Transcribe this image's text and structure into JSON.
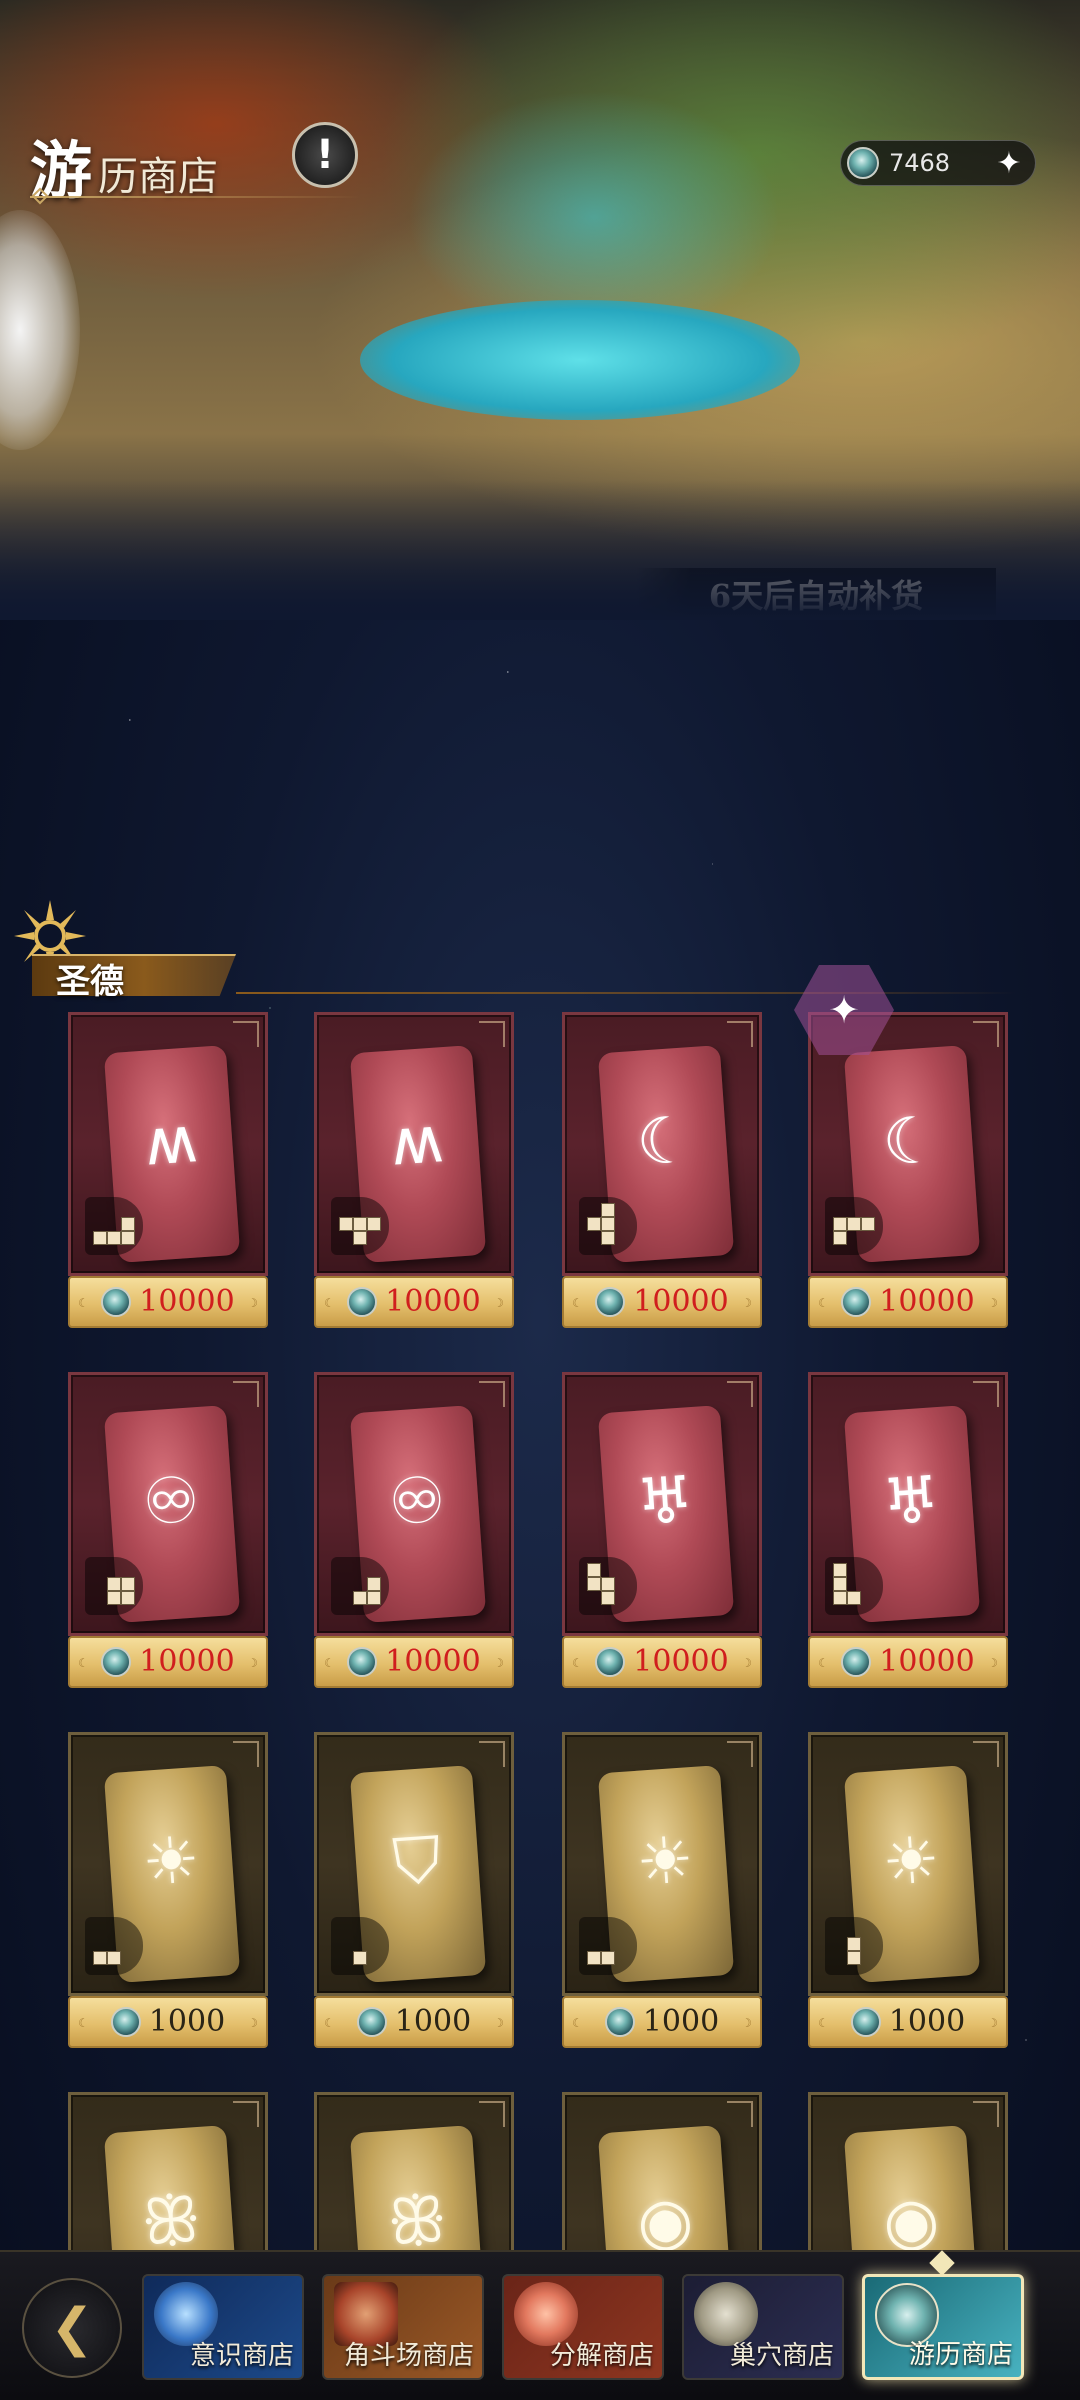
{
  "header": {
    "title_big": "游",
    "title_rest": "历商店",
    "info_icon": "exclamation-icon",
    "currency": {
      "icon": "coin-icon",
      "value": "7468",
      "add_icon": "sparkle-plus-icon"
    },
    "restock_text": "6天后自动补货"
  },
  "section": {
    "title": "圣德",
    "icon": "sun-emblem-icon"
  },
  "items": [
    {
      "glyph": "claw-icon",
      "symbol": "ʍ",
      "tier": "red",
      "price": "10000",
      "shape": "L-4"
    },
    {
      "glyph": "claw-icon",
      "symbol": "ʍ",
      "tier": "red",
      "price": "10000",
      "shape": "T-4"
    },
    {
      "glyph": "gear-moon-icon",
      "symbol": "☾",
      "tier": "red",
      "price": "10000",
      "shape": "S-4"
    },
    {
      "glyph": "gear-moon-icon",
      "symbol": "☾",
      "tier": "red",
      "price": "10000",
      "shape": "Z-4"
    },
    {
      "glyph": "meditation-icon",
      "symbol": "♾",
      "tier": "red",
      "price": "10000",
      "shape": "O-4"
    },
    {
      "glyph": "meditation-icon",
      "symbol": "♾",
      "tier": "red",
      "price": "10000",
      "shape": "L-3"
    },
    {
      "glyph": "chalice-icon",
      "symbol": "♅",
      "tier": "red",
      "price": "10000",
      "shape": "S-4b"
    },
    {
      "glyph": "chalice-icon",
      "symbol": "♅",
      "tier": "red",
      "price": "10000",
      "shape": "L-4b"
    },
    {
      "glyph": "sun-icon",
      "symbol": "☀",
      "tier": "gold",
      "price": "1000",
      "shape": "I-2"
    },
    {
      "glyph": "shield-icon",
      "symbol": "⛉",
      "tier": "gold",
      "price": "1000",
      "shape": "I-1"
    },
    {
      "glyph": "sun-icon",
      "symbol": "☀",
      "tier": "gold",
      "price": "1000",
      "shape": "I-2"
    },
    {
      "glyph": "sun-icon",
      "symbol": "☀",
      "tier": "gold",
      "price": "1000",
      "shape": "V-2"
    },
    {
      "glyph": "butterfly-icon",
      "symbol": "ꕥ",
      "tier": "gold",
      "price": "",
      "shape": ""
    },
    {
      "glyph": "butterfly-icon",
      "symbol": "ꕥ",
      "tier": "gold",
      "price": "",
      "shape": ""
    },
    {
      "glyph": "eye-icon",
      "symbol": "◉",
      "tier": "gold",
      "price": "",
      "shape": ""
    },
    {
      "glyph": "eye-icon",
      "symbol": "◉",
      "tier": "gold",
      "price": "",
      "shape": ""
    }
  ],
  "hex_badge_icon": "sparkle-icon",
  "nav": {
    "back_icon": "back-arrow-icon",
    "tabs": [
      {
        "label": "意识商店",
        "icon": "consciousness-icon"
      },
      {
        "label": "角斗场商店",
        "icon": "arena-shield-icon"
      },
      {
        "label": "分解商店",
        "icon": "flower-icon"
      },
      {
        "label": "巢穴商店",
        "icon": "nest-stone-icon"
      },
      {
        "label": "游历商店",
        "icon": "travel-coin-icon"
      }
    ],
    "active_tab": 4
  },
  "colors": {
    "price_red": "#d01e1e",
    "price_dark": "#2a2416",
    "accent_gold": "#c9a764",
    "bg_navy": "#0f1830"
  }
}
